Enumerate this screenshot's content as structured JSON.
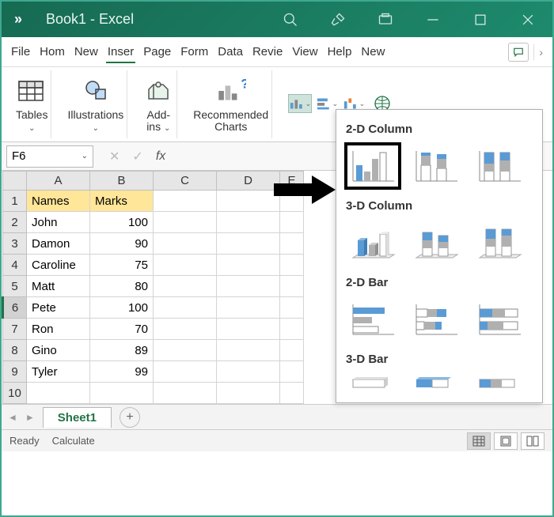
{
  "titlebar": {
    "overflow": "»",
    "docTitle": "Book1  -  Excel"
  },
  "tabs": [
    "File",
    "Hom",
    "New",
    "Inser",
    "Page",
    "Form",
    "Data",
    "Revie",
    "View",
    "Help",
    "New"
  ],
  "activeTabIndex": 3,
  "ribbon": {
    "tables": "Tables",
    "illustrations": "Illustrations",
    "addins": "Add-\nins",
    "recommended": "Recommended\nCharts"
  },
  "nameBox": "F6",
  "sheet": {
    "columns": [
      "A",
      "B",
      "C",
      "D",
      "E"
    ],
    "headerRow": [
      "Names",
      "Marks"
    ],
    "rows": [
      {
        "n": 2,
        "name": "John",
        "marks": 100
      },
      {
        "n": 3,
        "name": "Damon",
        "marks": 90
      },
      {
        "n": 4,
        "name": "Caroline",
        "marks": 75
      },
      {
        "n": 5,
        "name": "Matt",
        "marks": 80
      },
      {
        "n": 6,
        "name": "Pete",
        "marks": 100
      },
      {
        "n": 7,
        "name": "Ron",
        "marks": 70
      },
      {
        "n": 8,
        "name": "Gino",
        "marks": 89
      },
      {
        "n": 9,
        "name": "Tyler",
        "marks": 99
      }
    ],
    "emptyRow": 10
  },
  "sheetTabs": {
    "name": "Sheet1"
  },
  "statusbar": {
    "ready": "Ready",
    "calc": "Calculate"
  },
  "chartPanel": {
    "section1": "2-D Column",
    "section2": "3-D Column",
    "section3": "2-D Bar",
    "section4": "3-D Bar"
  },
  "chart_data": {
    "type": "table",
    "columns": [
      "Names",
      "Marks"
    ],
    "rows": [
      [
        "John",
        100
      ],
      [
        "Damon",
        90
      ],
      [
        "Caroline",
        75
      ],
      [
        "Matt",
        80
      ],
      [
        "Pete",
        100
      ],
      [
        "Ron",
        70
      ],
      [
        "Gino",
        89
      ],
      [
        "Tyler",
        99
      ]
    ]
  }
}
